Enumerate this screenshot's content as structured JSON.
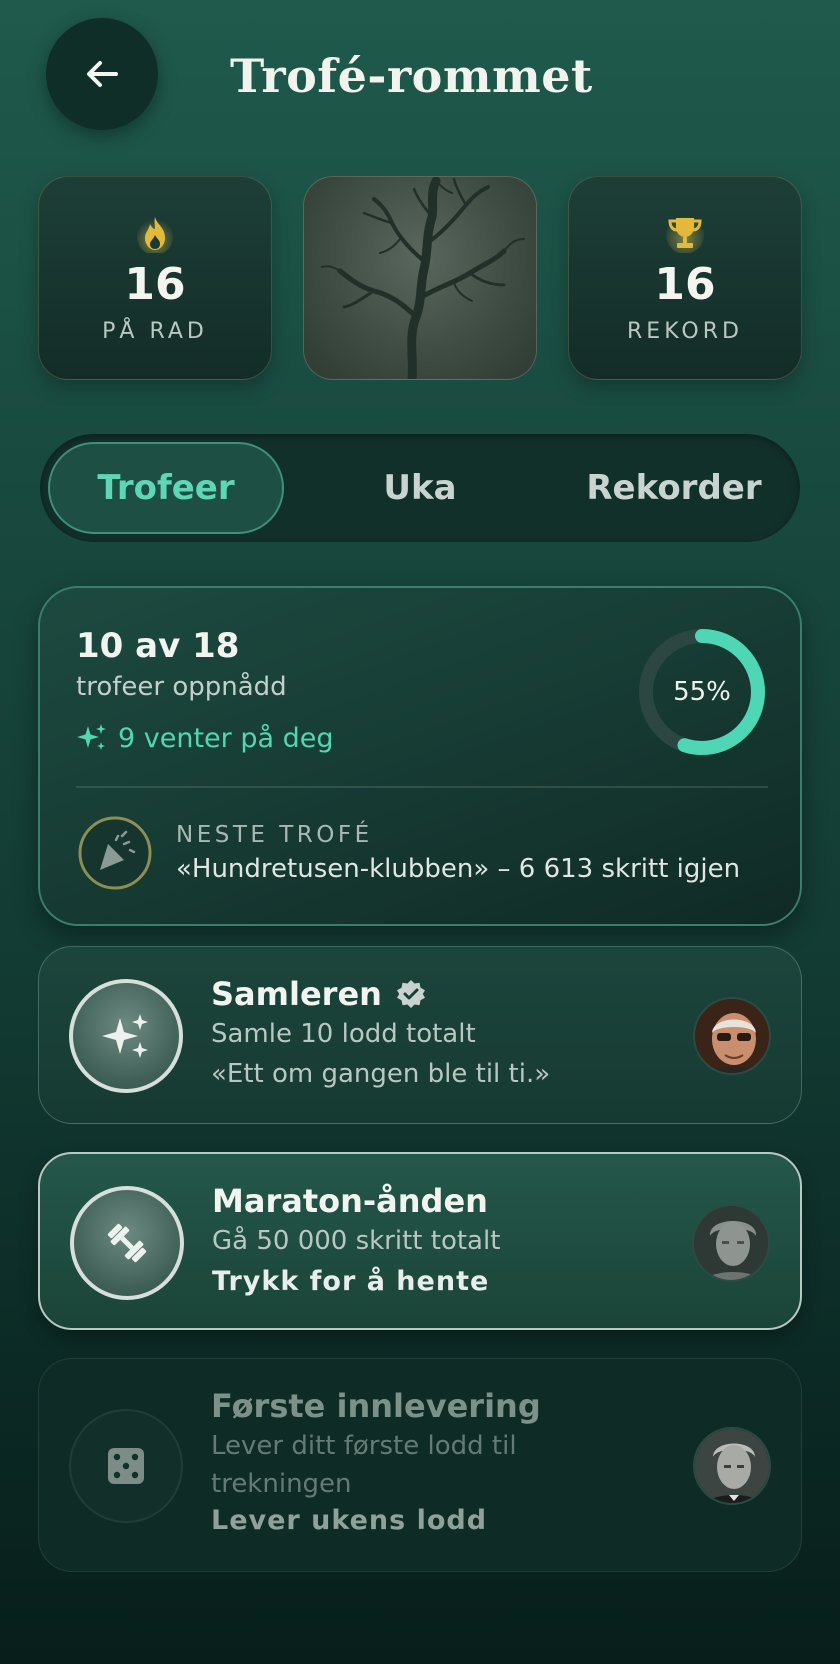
{
  "header": {
    "title": "Trofé-rommet",
    "back_icon": "arrow-left-icon"
  },
  "stats": {
    "streak": {
      "value": "16",
      "label": "PÅ RAD",
      "icon": "flame-icon",
      "color": "#e2b93b"
    },
    "record": {
      "value": "16",
      "label": "REKORD",
      "icon": "trophy-icon",
      "color": "#e2b93b"
    }
  },
  "tabs": [
    {
      "label": "Trofeer",
      "active": true
    },
    {
      "label": "Uka",
      "active": false
    },
    {
      "label": "Rekorder",
      "active": false
    }
  ],
  "progress": {
    "count_text": "10 av 18",
    "subtitle": "trofeer oppnådd",
    "waiting_text": "9 venter på deg",
    "percent_text": "55%",
    "percent": 55,
    "next_label": "NESTE TROFÉ",
    "next_text": "«Hundretusen-klubben» – 6 613 skritt igjen",
    "accent": "#4fd6b4"
  },
  "trophies": [
    {
      "title": "Samleren",
      "description": "Samle 10 lodd totalt",
      "quote": "«Ett om gangen ble til ti.»",
      "icon": "sparkles-icon",
      "verified": true
    },
    {
      "title": "Maraton-ånden",
      "description": "Gå 50 000 skritt totalt",
      "action": "Trykk for å hente",
      "icon": "dumbbell-icon"
    },
    {
      "title": "Første innlevering",
      "description": "Lever ditt første lodd til trekningen",
      "action": "Lever ukens lodd",
      "icon": "dice-icon"
    }
  ]
}
